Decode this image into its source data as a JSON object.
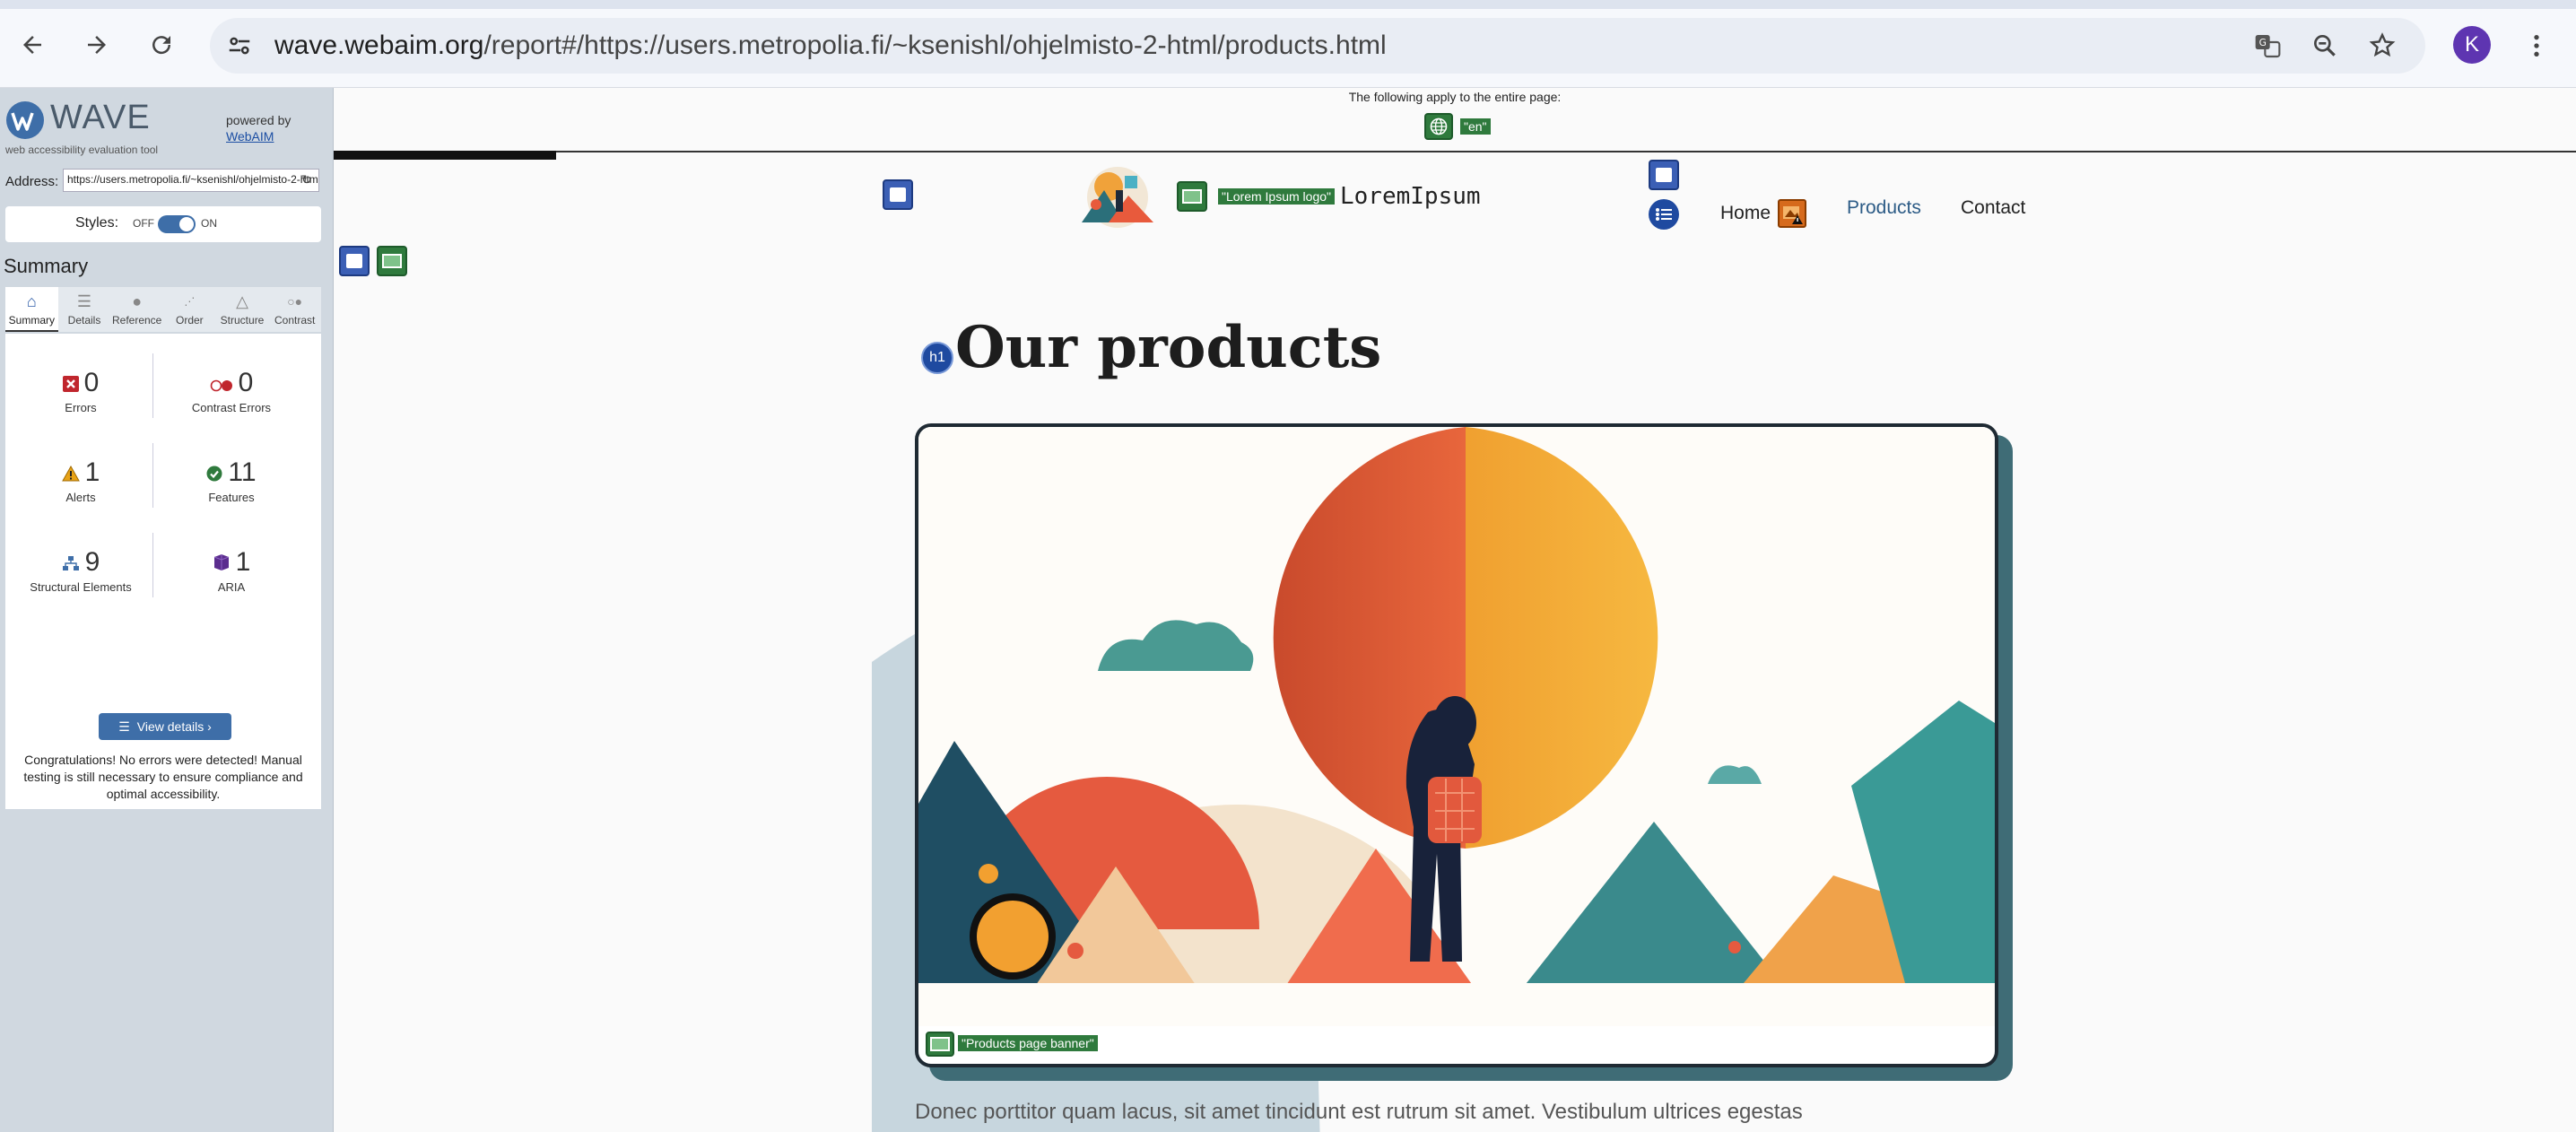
{
  "browser": {
    "url_host": "wave.webaim.org",
    "url_path": "/report#/https://users.metropolia.fi/~ksenishl/ohjelmisto-2-html/products.html",
    "profile_initial": "K",
    "icons": [
      "back-arrow-icon",
      "forward-arrow-icon",
      "reload-icon",
      "site-info-icon",
      "translate-icon",
      "zoom-icon",
      "bookmark-star-icon",
      "menu-dots-icon"
    ]
  },
  "wave": {
    "title": "WAVE",
    "subtitle": "web accessibility evaluation tool",
    "powered_by": "powered by",
    "webaim": "WebAIM",
    "address_label": "Address:",
    "address_value": "https://users.metropolia.fi/~ksenishl/ohjelmisto-2-html/products.html",
    "styles_label": "Styles:",
    "styles_off": "OFF",
    "styles_on": "ON",
    "summary_heading": "Summary",
    "tabs": [
      {
        "label": "Summary",
        "icon": "home-icon"
      },
      {
        "label": "Details",
        "icon": "list-icon"
      },
      {
        "label": "Reference",
        "icon": "info-icon"
      },
      {
        "label": "Order",
        "icon": "order-icon"
      },
      {
        "label": "Structure",
        "icon": "structure-icon"
      },
      {
        "label": "Contrast",
        "icon": "contrast-icon"
      }
    ],
    "stats": {
      "errors": {
        "value": "0",
        "label": "Errors"
      },
      "contrast_errors": {
        "value": "0",
        "label": "Contrast Errors"
      },
      "alerts": {
        "value": "1",
        "label": "Alerts"
      },
      "features": {
        "value": "11",
        "label": "Features"
      },
      "structural": {
        "value": "9",
        "label": "Structural Elements"
      },
      "aria": {
        "value": "1",
        "label": "ARIA"
      }
    },
    "view_details": "View details ›",
    "congrats": "Congratulations! No errors were detected! Manual testing is still necessary to ensure compliance and optimal accessibility."
  },
  "page": {
    "entire_page_note": "The following apply to the entire page:",
    "lang_label": "\"en\"",
    "logo_alt": "\"Lorem Ipsum logo\"",
    "logo_text": "LoremIpsum",
    "nav": {
      "home": "Home",
      "products": "Products",
      "contact": "Contact"
    },
    "h1_badge": "h1",
    "title": "Our products",
    "banner_alt": "\"Products page banner\"",
    "paragraph": "Donec porttitor quam lacus, sit amet tincidunt est rutrum sit amet. Vestibulum ultrices egestas"
  },
  "colors": {
    "wave_blue": "#3e6ea8",
    "feature_green": "#2f7a3d",
    "nav_active": "#2c5b86",
    "sidebar_bg": "#d0d8e0"
  }
}
